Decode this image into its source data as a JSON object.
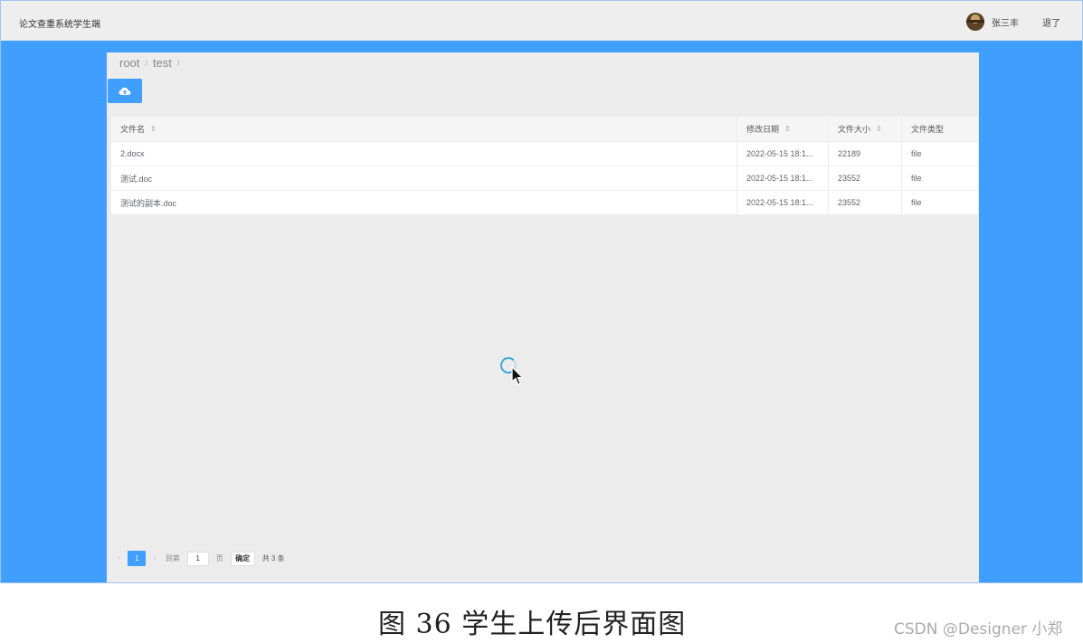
{
  "app": {
    "title": "论文查重系统学生端"
  },
  "user": {
    "name": "张三丰",
    "logout_label": "退了"
  },
  "breadcrumb": [
    "root",
    "test"
  ],
  "breadcrumb_sep": "/",
  "upload": {
    "icon": "cloud-upload-icon"
  },
  "table": {
    "headers": {
      "name": "文件名",
      "date": "修改日期",
      "size": "文件大小",
      "type": "文件类型"
    },
    "rows": [
      {
        "name": "2.docx",
        "date": "2022-05-15 18:1...",
        "size": "22189",
        "type": "file"
      },
      {
        "name": "测试.doc",
        "date": "2022-05-15 18:1...",
        "size": "23552",
        "type": "file"
      },
      {
        "name": "测试的副本.doc",
        "date": "2022-05-15 18:1...",
        "size": "23552",
        "type": "file"
      }
    ]
  },
  "pagination": {
    "current": "1",
    "goto_label": "到第",
    "goto_value": "1",
    "page_unit": "页",
    "confirm_label": "确定",
    "total_label": "共 3 条"
  },
  "caption": "图 36 学生上传后界面图",
  "watermark": "CSDN @Designer 小郑",
  "colors": {
    "accent": "#409eff",
    "panel": "#ececec",
    "topbar": "#eeeeee"
  }
}
